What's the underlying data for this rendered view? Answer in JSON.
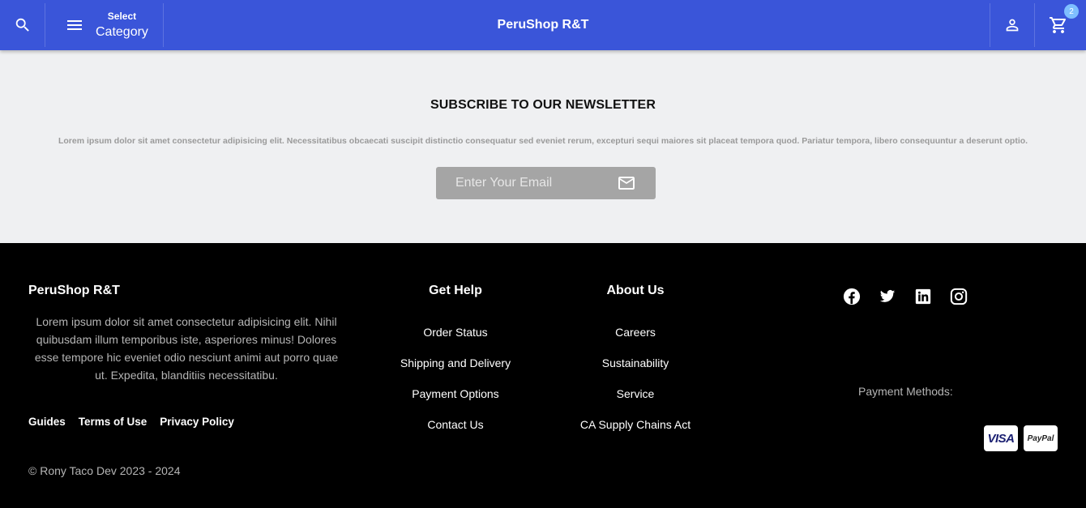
{
  "header": {
    "category_small": "Select",
    "category_large": "Category",
    "brand": "PeruShop R&T",
    "cart_count": "2",
    "icons": {
      "search": "search-icon",
      "menu": "menu-icon",
      "account": "person-icon",
      "cart": "cart-icon"
    }
  },
  "newsletter": {
    "title": "SUBSCRIBE TO OUR NEWSLETTER",
    "text": "Lorem ipsum dolor sit amet consectetur adipisicing elit. Necessitatibus obcaecati suscipit distinctio consequatur sed eveniet rerum, excepturi sequi maiores sit placeat tempora quod. Pariatur tempora, libero consequuntur a deserunt optio.",
    "email_placeholder": "Enter Your Email",
    "submit_icon": "mail-icon"
  },
  "footer": {
    "brand": "PeruShop R&T",
    "about": "Lorem ipsum dolor sit amet consectetur adipisicing elit. Nihil quibusdam illum temporibus iste, asperiores minus! Dolores esse tempore hic eveniet odio nesciunt animi aut porro quae ut. Expedita, blanditiis necessitatibu.",
    "links": [
      "Guides",
      "Terms of Use",
      "Privacy Policy"
    ],
    "copyright": "© Rony Taco Dev 2023 - 2024",
    "get_help": {
      "title": "Get Help",
      "items": [
        "Order Status",
        "Shipping and Delivery",
        "Payment Options",
        "Contact Us"
      ]
    },
    "about_us": {
      "title": "About Us",
      "items": [
        "Careers",
        "Sustainability",
        "Service",
        "CA Supply Chains Act"
      ]
    },
    "socials": [
      "facebook-icon",
      "twitter-icon",
      "linkedin-icon",
      "instagram-icon"
    ],
    "payment_label": "Payment Methods:",
    "payment_methods": [
      "VISA",
      "PayPal"
    ]
  },
  "colors": {
    "header_bg": "#3a55d9",
    "newsletter_bg": "#eff0f2",
    "footer_bg": "#000000",
    "badge_bg": "#7fbfff"
  }
}
